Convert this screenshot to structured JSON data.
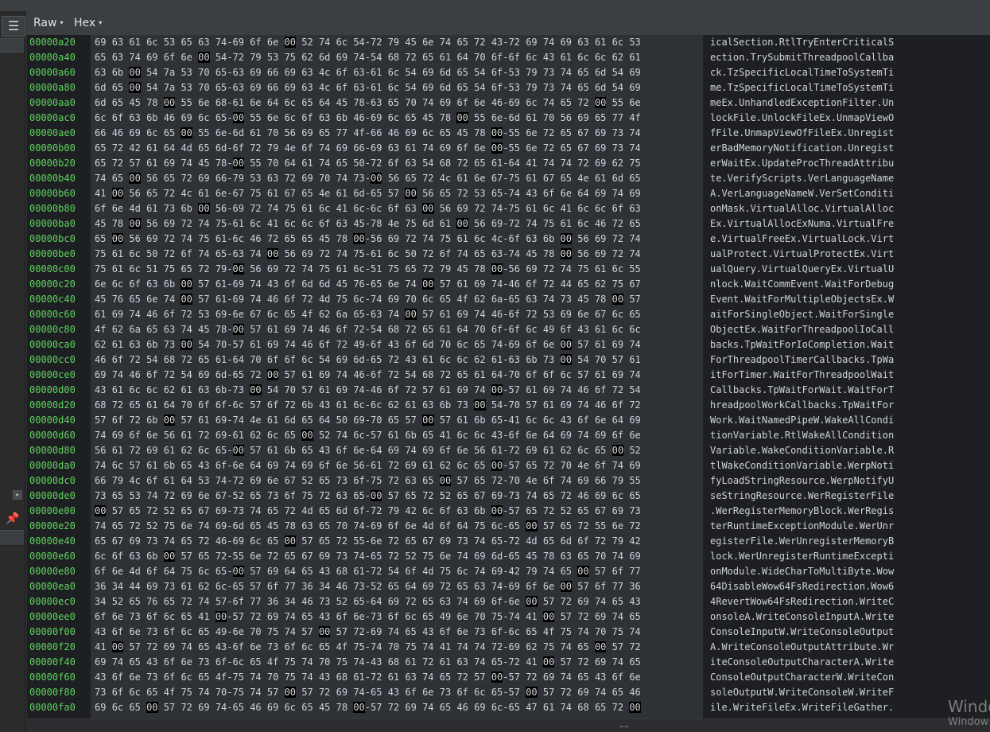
{
  "menu": {
    "icon": "hamburger-menu-icon",
    "glyph": "☰"
  },
  "tabs": [
    {
      "label": "Raw",
      "caret": "▾"
    },
    {
      "label": "Hex",
      "caret": "▾"
    }
  ],
  "sidebar": {
    "pin_icon": "pin-icon",
    "pin_glyph": "📌",
    "expand_icon": "chevron-right-icon",
    "expand_glyph": "▸"
  },
  "colors": {
    "address": "#5fd35f",
    "bytes": "#cfd3da",
    "background": "#1e1f22",
    "byte_panel": "#2e3136",
    "null_byte_bg": "#000000"
  },
  "hex_rows": [
    {
      "address": "00000a20",
      "bytes": "69 63 61 6c 53 65 63 74-69 6f 6e 00 52 74 6c 54-72 79 45 6e 74 65 72 43-72 69 74 69 63 61 6c 53",
      "ascii": "icalSection.RtlTryEnterCriticalS"
    },
    {
      "address": "00000a40",
      "bytes": "65 63 74 69 6f 6e 00 54-72 79 53 75 62 6d 69 74-54 68 72 65 61 64 70 6f-6f 6c 43 61 6c 6c 62 61",
      "ascii": "ection.TrySubmitThreadpoolCallba"
    },
    {
      "address": "00000a60",
      "bytes": "63 6b 00 54 7a 53 70 65-63 69 66 69 63 4c 6f 63-61 6c 54 69 6d 65 54 6f-53 79 73 74 65 6d 54 69",
      "ascii": "ck.TzSpecificLocalTimeToSystemTi"
    },
    {
      "address": "00000a80",
      "bytes": "6d 65 00 54 7a 53 70 65-63 69 66 69 63 4c 6f 63-61 6c 54 69 6d 65 54 6f-53 79 73 74 65 6d 54 69",
      "ascii": "me.TzSpecificLocalTimeToSystemTi"
    },
    {
      "address": "00000aa0",
      "bytes": "6d 65 45 78 00 55 6e 68-61 6e 64 6c 65 64 45 78-63 65 70 74 69 6f 6e 46-69 6c 74 65 72 00 55 6e",
      "ascii": "meEx.UnhandledExceptionFilter.Un"
    },
    {
      "address": "00000ac0",
      "bytes": "6c 6f 63 6b 46 69 6c 65-00 55 6e 6c 6f 63 6b 46-69 6c 65 45 78 00 55 6e-6d 61 70 56 69 65 77 4f",
      "ascii": "lockFile.UnlockFileEx.UnmapViewO"
    },
    {
      "address": "00000ae0",
      "bytes": "66 46 69 6c 65 00 55 6e-6d 61 70 56 69 65 77 4f-66 46 69 6c 65 45 78 00-55 6e 72 65 67 69 73 74",
      "ascii": "fFile.UnmapViewOfFileEx.Unregist"
    },
    {
      "address": "00000b00",
      "bytes": "65 72 42 61 64 4d 65 6d-6f 72 79 4e 6f 74 69 66-69 63 61 74 69 6f 6e 00-55 6e 72 65 67 69 73 74",
      "ascii": "erBadMemoryNotification.Unregist"
    },
    {
      "address": "00000b20",
      "bytes": "65 72 57 61 69 74 45 78-00 55 70 64 61 74 65 50-72 6f 63 54 68 72 65 61-64 41 74 74 72 69 62 75",
      "ascii": "erWaitEx.UpdateProcThreadAttribu"
    },
    {
      "address": "00000b40",
      "bytes": "74 65 00 56 65 72 69 66-79 53 63 72 69 70 74 73-00 56 65 72 4c 61 6e 67-75 61 67 65 4e 61 6d 65",
      "ascii": "te.VerifyScripts.VerLanguageName"
    },
    {
      "address": "00000b60",
      "bytes": "41 00 56 65 72 4c 61 6e-67 75 61 67 65 4e 61 6d-65 57 00 56 65 72 53 65-74 43 6f 6e 64 69 74 69",
      "ascii": "A.VerLanguageNameW.VerSetConditi"
    },
    {
      "address": "00000b80",
      "bytes": "6f 6e 4d 61 73 6b 00 56-69 72 74 75 61 6c 41 6c-6c 6f 63 00 56 69 72 74-75 61 6c 41 6c 6c 6f 63",
      "ascii": "onMask.VirtualAlloc.VirtualAlloc"
    },
    {
      "address": "00000ba0",
      "bytes": "45 78 00 56 69 72 74 75-61 6c 41 6c 6c 6f 63 45-78 4e 75 6d 61 00 56 69-72 74 75 61 6c 46 72 65",
      "ascii": "Ex.VirtualAllocExNuma.VirtualFre"
    },
    {
      "address": "00000bc0",
      "bytes": "65 00 56 69 72 74 75 61-6c 46 72 65 65 45 78 00-56 69 72 74 75 61 6c 4c-6f 63 6b 00 56 69 72 74",
      "ascii": "e.VirtualFreeEx.VirtualLock.Virt"
    },
    {
      "address": "00000be0",
      "bytes": "75 61 6c 50 72 6f 74 65-63 74 00 56 69 72 74 75-61 6c 50 72 6f 74 65 63-74 45 78 00 56 69 72 74",
      "ascii": "ualProtect.VirtualProtectEx.Virt"
    },
    {
      "address": "00000c00",
      "bytes": "75 61 6c 51 75 65 72 79-00 56 69 72 74 75 61 6c-51 75 65 72 79 45 78 00-56 69 72 74 75 61 6c 55",
      "ascii": "ualQuery.VirtualQueryEx.VirtualU"
    },
    {
      "address": "00000c20",
      "bytes": "6e 6c 6f 63 6b 00 57 61-69 74 43 6f 6d 6d 45 76-65 6e 74 00 57 61 69 74-46 6f 72 44 65 62 75 67",
      "ascii": "nlock.WaitCommEvent.WaitForDebug"
    },
    {
      "address": "00000c40",
      "bytes": "45 76 65 6e 74 00 57 61-69 74 46 6f 72 4d 75 6c-74 69 70 6c 65 4f 62 6a-65 63 74 73 45 78 00 57",
      "ascii": "Event.WaitForMultipleObjectsEx.W"
    },
    {
      "address": "00000c60",
      "bytes": "61 69 74 46 6f 72 53 69-6e 67 6c 65 4f 62 6a 65-63 74 00 57 61 69 74 46-6f 72 53 69 6e 67 6c 65",
      "ascii": "aitForSingleObject.WaitForSingle"
    },
    {
      "address": "00000c80",
      "bytes": "4f 62 6a 65 63 74 45 78-00 57 61 69 74 46 6f 72-54 68 72 65 61 64 70 6f-6f 6c 49 6f 43 61 6c 6c",
      "ascii": "ObjectEx.WaitForThreadpoolIoCall"
    },
    {
      "address": "00000ca0",
      "bytes": "62 61 63 6b 73 00 54 70-57 61 69 74 46 6f 72 49-6f 43 6f 6d 70 6c 65 74-69 6f 6e 00 57 61 69 74",
      "ascii": "backs.TpWaitForIoCompletion.Wait"
    },
    {
      "address": "00000cc0",
      "bytes": "46 6f 72 54 68 72 65 61-64 70 6f 6f 6c 54 69 6d-65 72 43 61 6c 6c 62 61-63 6b 73 00 54 70 57 61",
      "ascii": "ForThreadpoolTimerCallbacks.TpWa"
    },
    {
      "address": "00000ce0",
      "bytes": "69 74 46 6f 72 54 69 6d-65 72 00 57 61 69 74 46-6f 72 54 68 72 65 61 64-70 6f 6f 6c 57 61 69 74",
      "ascii": "itForTimer.WaitForThreadpoolWait"
    },
    {
      "address": "00000d00",
      "bytes": "43 61 6c 6c 62 61 63 6b-73 00 54 70 57 61 69 74-46 6f 72 57 61 69 74 00-57 61 69 74 46 6f 72 54",
      "ascii": "Callbacks.TpWaitForWait.WaitForT"
    },
    {
      "address": "00000d20",
      "bytes": "68 72 65 61 64 70 6f 6f-6c 57 6f 72 6b 43 61 6c-6c 62 61 63 6b 73 00 54-70 57 61 69 74 46 6f 72",
      "ascii": "hreadpoolWorkCallbacks.TpWaitFor"
    },
    {
      "address": "00000d40",
      "bytes": "57 6f 72 6b 00 57 61 69-74 4e 61 6d 65 64 50 69-70 65 57 00 57 61 6b 65-41 6c 6c 43 6f 6e 64 69",
      "ascii": "Work.WaitNamedPipeW.WakeAllCondi"
    },
    {
      "address": "00000d60",
      "bytes": "74 69 6f 6e 56 61 72 69-61 62 6c 65 00 52 74 6c-57 61 6b 65 41 6c 6c 43-6f 6e 64 69 74 69 6f 6e",
      "ascii": "tionVariable.RtlWakeAllCondition"
    },
    {
      "address": "00000d80",
      "bytes": "56 61 72 69 61 62 6c 65-00 57 61 6b 65 43 6f 6e-64 69 74 69 6f 6e 56 61-72 69 61 62 6c 65 00 52",
      "ascii": "Variable.WakeConditionVariable.R"
    },
    {
      "address": "00000da0",
      "bytes": "74 6c 57 61 6b 65 43 6f-6e 64 69 74 69 6f 6e 56-61 72 69 61 62 6c 65 00-57 65 72 70 4e 6f 74 69",
      "ascii": "tlWakeConditionVariable.WerpNoti"
    },
    {
      "address": "00000dc0",
      "bytes": "66 79 4c 6f 61 64 53 74-72 69 6e 67 52 65 73 6f-75 72 63 65 00 57 65 72-70 4e 6f 74 69 66 79 55",
      "ascii": "fyLoadStringResource.WerpNotifyU"
    },
    {
      "address": "00000de0",
      "bytes": "73 65 53 74 72 69 6e 67-52 65 73 6f 75 72 63 65-00 57 65 72 52 65 67 69-73 74 65 72 46 69 6c 65",
      "ascii": "seStringResource.WerRegisterFile"
    },
    {
      "address": "00000e00",
      "bytes": "00 57 65 72 52 65 67 69-73 74 65 72 4d 65 6d 6f-72 79 42 6c 6f 63 6b 00-57 65 72 52 65 67 69 73",
      "ascii": ".WerRegisterMemoryBlock.WerRegis"
    },
    {
      "address": "00000e20",
      "bytes": "74 65 72 52 75 6e 74 69-6d 65 45 78 63 65 70 74-69 6f 6e 4d 6f 64 75 6c-65 00 57 65 72 55 6e 72",
      "ascii": "terRuntimeExceptionModule.WerUnr"
    },
    {
      "address": "00000e40",
      "bytes": "65 67 69 73 74 65 72 46-69 6c 65 00 57 65 72 55-6e 72 65 67 69 73 74 65-72 4d 65 6d 6f 72 79 42",
      "ascii": "egisterFile.WerUnregisterMemoryB"
    },
    {
      "address": "00000e60",
      "bytes": "6c 6f 63 6b 00 57 65 72-55 6e 72 65 67 69 73 74-65 72 52 75 6e 74 69 6d-65 45 78 63 65 70 74 69",
      "ascii": "lock.WerUnregisterRuntimeExcepti"
    },
    {
      "address": "00000e80",
      "bytes": "6f 6e 4d 6f 64 75 6c 65-00 57 69 64 65 43 68 61-72 54 6f 4d 75 6c 74 69-42 79 74 65 00 57 6f 77",
      "ascii": "onModule.WideCharToMultiByte.Wow"
    },
    {
      "address": "00000ea0",
      "bytes": "36 34 44 69 73 61 62 6c-65 57 6f 77 36 34 46 73-52 65 64 69 72 65 63 74-69 6f 6e 00 57 6f 77 36",
      "ascii": "64DisableWow64FsRedirection.Wow6"
    },
    {
      "address": "00000ec0",
      "bytes": "34 52 65 76 65 72 74 57-6f 77 36 34 46 73 52 65-64 69 72 65 63 74 69 6f-6e 00 57 72 69 74 65 43",
      "ascii": "4RevertWow64FsRedirection.WriteC"
    },
    {
      "address": "00000ee0",
      "bytes": "6f 6e 73 6f 6c 65 41 00-57 72 69 74 65 43 6f 6e-73 6f 6c 65 49 6e 70 75-74 41 00 57 72 69 74 65",
      "ascii": "onsoleA.WriteConsoleInputA.Write"
    },
    {
      "address": "00000f00",
      "bytes": "43 6f 6e 73 6f 6c 65 49-6e 70 75 74 57 00 57 72-69 74 65 43 6f 6e 73 6f-6c 65 4f 75 74 70 75 74",
      "ascii": "ConsoleInputW.WriteConsoleOutput"
    },
    {
      "address": "00000f20",
      "bytes": "41 00 57 72 69 74 65 43-6f 6e 73 6f 6c 65 4f 75-74 70 75 74 41 74 74 72-69 62 75 74 65 00 57 72",
      "ascii": "A.WriteConsoleOutputAttribute.Wr"
    },
    {
      "address": "00000f40",
      "bytes": "69 74 65 43 6f 6e 73 6f-6c 65 4f 75 74 70 75 74-43 68 61 72 61 63 74 65-72 41 00 57 72 69 74 65",
      "ascii": "iteConsoleOutputCharacterA.Write"
    },
    {
      "address": "00000f60",
      "bytes": "43 6f 6e 73 6f 6c 65 4f-75 74 70 75 74 43 68 61-72 61 63 74 65 72 57 00-57 72 69 74 65 43 6f 6e",
      "ascii": "ConsoleOutputCharacterW.WriteCon"
    },
    {
      "address": "00000f80",
      "bytes": "73 6f 6c 65 4f 75 74 70-75 74 57 00 57 72 69 74-65 43 6f 6e 73 6f 6c 65-57 00 57 72 69 74 65 46",
      "ascii": "soleOutputW.WriteConsoleW.WriteF"
    },
    {
      "address": "00000fa0",
      "bytes": "69 6c 65 00 57 72 69 74-65 46 69 6c 65 45 78 00-57 72 69 74 65 46 69 6c-65 47 61 74 68 65 72 00",
      "ascii": "ile.WriteFileEx.WriteFileGather."
    }
  ],
  "watermark": {
    "line1": "Windo",
    "line2": "Window"
  },
  "grip": "……"
}
